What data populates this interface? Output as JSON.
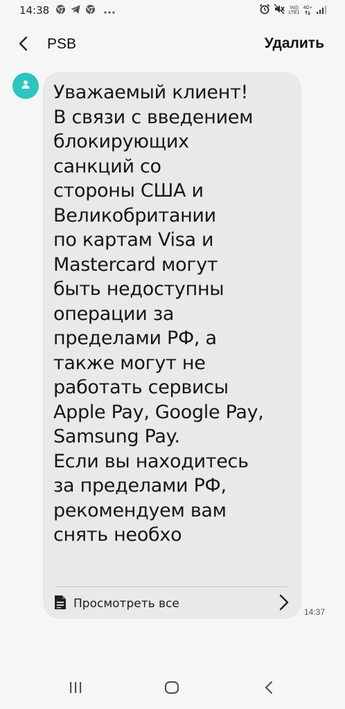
{
  "status_bar": {
    "time": "14:38",
    "volte_label": "Vo))",
    "lte_label": "LTE1",
    "network_label": "4G+"
  },
  "header": {
    "contact_name": "PSB",
    "delete_label": "Удалить"
  },
  "message": {
    "text": "Уважаемый клиент!\nВ связи с введением\nблокирующих\nсанкций со\nстороны США и\nВеликобритании\nпо картам Visa и\nMastercard могут\nбыть недоступны\nоперации за\nпределами РФ, а\nтакже могут не\nработать сервисы\nApple Pay, Google Pay,\nSamsung Pay.\nЕсли вы находитесь\nза пределами РФ,\nрекомендуем вам\nснять необхо",
    "view_all_label": "Просмотреть все",
    "time": "14:37"
  },
  "colors": {
    "background": "#f6f6f6",
    "bubble": "#e9e9e9",
    "avatar": "#2ec4c0",
    "text": "#161616"
  },
  "icons": {
    "status_left": [
      "chrome-icon",
      "telegram-icon",
      "chrome-icon",
      "more-dots-icon"
    ],
    "status_right": [
      "alarm-icon",
      "mute-icon",
      "volte-icon",
      "network-icon",
      "signal-icon"
    ],
    "header": [
      "back-arrow-icon"
    ],
    "avatar": "person-icon",
    "view_all": [
      "document-icon",
      "chevron-right-icon"
    ],
    "nav": [
      "recents-icon",
      "home-icon",
      "back-icon"
    ]
  }
}
